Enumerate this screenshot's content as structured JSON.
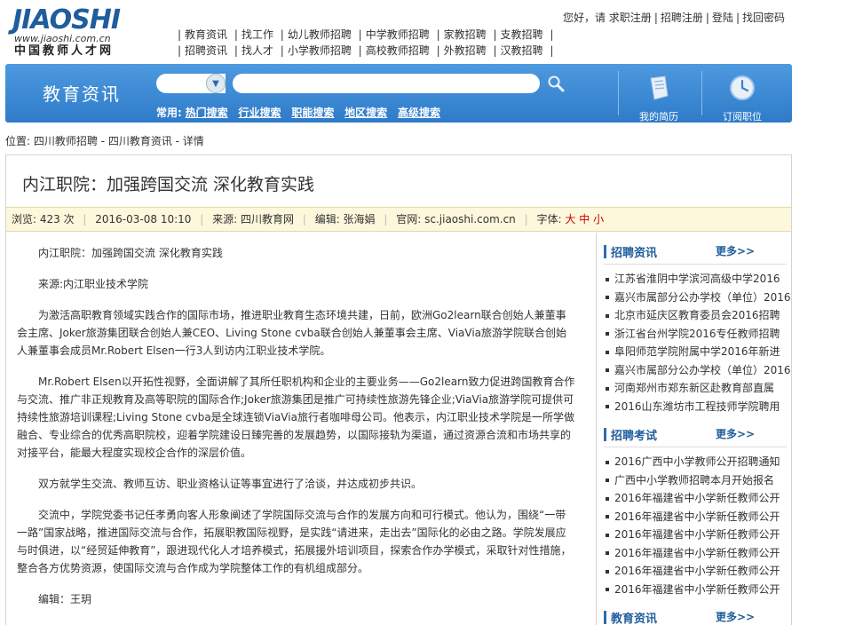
{
  "logo": {
    "brand": "JIAOSHI",
    "domain": "www.jiaoshi.com.cn",
    "cn": "中国教师人才网"
  },
  "user_links": [
    "您好，请 求职注册",
    "招聘注册",
    "登陆",
    "找回密码"
  ],
  "top_nav": {
    "row1": [
      "教育资讯",
      "找工作",
      "幼儿教师招聘",
      "中学教师招聘",
      "家教招聘",
      "支教招聘"
    ],
    "row2": [
      "招聘资讯",
      "找人才",
      "小学教师招聘",
      "高校教师招聘",
      "外教招聘",
      "汉教招聘"
    ]
  },
  "search": {
    "section_title": "教育资讯",
    "keyword_value": "",
    "common_label": "常用:",
    "quick_links": [
      "热门搜索",
      "行业搜索",
      "职能搜索",
      "地区搜索",
      "高级搜索"
    ]
  },
  "tools": {
    "resume": "我的简历",
    "subscribe": "订阅职位"
  },
  "breadcrumb": "位置: 四川教师招聘 - 四川教育资讯 - 详情",
  "article": {
    "title": "内江职院：加强跨国交流 深化教育实践",
    "meta": {
      "views": "浏览: 423 次",
      "date": "2016-03-08 10:10",
      "source": "来源: 四川教育网",
      "editor": "编辑: 张海娟",
      "site": "官网: sc.jiaoshi.com.cn",
      "font_label": "字体:",
      "sizes": [
        "大",
        "中",
        "小"
      ]
    },
    "paragraphs": [
      "内江职院：加强跨国交流 深化教育实践",
      "来源:内江职业技术学院",
      "为激活高职教育领域实践合作的国际市场，推进职业教育生态环境共建，日前，欧洲Go2learn联合创始人兼董事会主席、Joker旅游集团联合创始人兼CEO、Living Stone cvba联合创始人兼董事会主席、ViaVia旅游学院联合创始人兼董事会成员Mr.Robert Elsen一行3人到访内江职业技术学院。",
      "Mr.Robert Elsen以开拓性视野，全面讲解了其所任职机构和企业的主要业务——Go2learn致力促进跨国教育合作与交流、推广非正规教育及高等职院的国际合作;Joker旅游集团是推广可持续性旅游先锋企业;ViaVia旅游学院可提供可持续性旅游培训课程;Living Stone cvba是全球连锁ViaVia旅行者咖啡母公司。他表示，内江职业技术学院是一所学做融合、专业综合的优秀高职院校，迎着学院建设日臻完善的发展趋势，以国际接轨为渠道，通过资源合流和市场共享的对接平台，能最大程度实现校企合作的深层价值。",
      "双方就学生交流、教师互访、职业资格认证等事宜进行了洽谈，并达成初步共识。",
      "交流中，学院党委书记任孝勇向客人形象阐述了学院国际交流与合作的发展方向和可行模式。他认为，围绕“一带一路”国家战略，推进国际交流与合作，拓展职教国际视野，是实践“请进来，走出去”国际化的必由之路。学院发展应与时俱进，以“经贸延伸教育”，跟进现代化人才培养模式，拓展援外培训项目，探索合作办学模式，采取针对性措施，整合各方优势资源，使国际交流与合作成为学院整体工作的有机组成部分。",
      "编辑：王玥"
    ]
  },
  "sidebar": {
    "recruit_info": {
      "title": "招聘资讯",
      "more": "更多>>",
      "items": [
        "江苏省淮阴中学滨河高级中学2016",
        "嘉兴市属部分公办学校（单位）2016",
        "北京市延庆区教育委员会2016招聘",
        "浙江省台州学院2016专任教师招聘",
        "阜阳师范学院附属中学2016年新进",
        "嘉兴市属部分公办学校（单位）2016",
        "河南郑州市郑东新区赴教育部直属",
        "2016山东潍坊市工程技师学院聘用"
      ]
    },
    "recruit_exam": {
      "title": "招聘考试",
      "more": "更多>>",
      "items": [
        "2016广西中小学教师公开招聘通知",
        "广西中小学教师招聘本月开始报名",
        "2016年福建省中小学新任教师公开",
        "2016年福建省中小学新任教师公开",
        "2016年福建省中小学新任教师公开",
        "2016年福建省中小学新任教师公开",
        "2016年福建省中小学新任教师公开",
        "2016年福建省中小学新任教师公开"
      ]
    },
    "edu_news": {
      "title": "教育资讯",
      "more": "更多>>"
    }
  }
}
